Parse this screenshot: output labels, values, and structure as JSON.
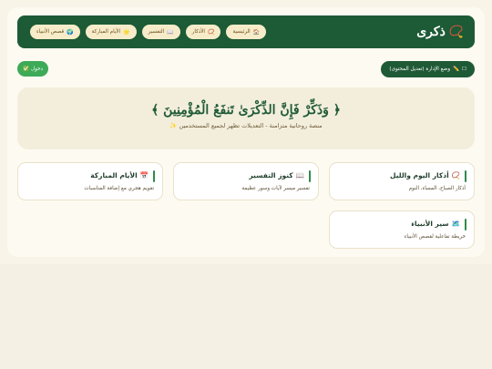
{
  "brand": {
    "name": "ذكرى",
    "icon": "prayer-beads-icon",
    "accent": "#e0b84a"
  },
  "nav": [
    {
      "icon": "🏠",
      "label": "الرئيسية"
    },
    {
      "icon": "📿",
      "label": "الأذكار"
    },
    {
      "icon": "📖",
      "label": "التفسير"
    },
    {
      "icon": "🌟",
      "label": "الأيام المباركة"
    },
    {
      "icon": "🌍",
      "label": "قصص الأنبياء"
    }
  ],
  "admin": {
    "checkbox": "☐",
    "icon": "✏️",
    "label": "وضع الإدارة (تعديل المحتوى)"
  },
  "login": {
    "icon": "✅",
    "label": "دخول"
  },
  "hero": {
    "title": "﴿ وَذَكِّرْ فَإِنَّ الذِّكْرَىٰ تَنفَعُ الْمُؤْمِنِينَ ﴾",
    "subtitle": "منصة روحانية متزامنة - التعديلات تظهر لجميع المستخدمين ✨"
  },
  "tiles": [
    {
      "icon": "📿",
      "title": "أذكار اليوم والليل",
      "desc": "أذكار الصباح، المساء، النوم"
    },
    {
      "icon": "📖",
      "title": "كنوز التفسير",
      "desc": "تفسير ميسر لآيات وسور عظيمة"
    },
    {
      "icon": "📅",
      "title": "الأيام المباركة",
      "desc": "تقويم هجري مع إضافة المناسبات"
    },
    {
      "icon": "🗺️",
      "title": "سير الأنبياء",
      "desc": "خريطة تفاعلية لقصص الأنبياء"
    }
  ],
  "colors": {
    "primary": "#1d5a36",
    "success": "#3daa58",
    "background": "#f8f4e8"
  }
}
